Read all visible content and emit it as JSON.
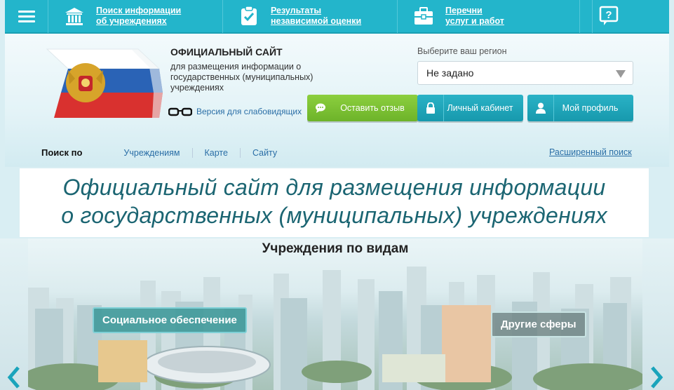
{
  "topnav": {
    "items": [
      {
        "label_line1": "Поиск информации",
        "label_line2": "об учреждениях",
        "icon": "institution-icon"
      },
      {
        "label_line1": "Результаты",
        "label_line2": "независимой оценки",
        "icon": "clipboard-check-icon"
      },
      {
        "label_line1": "Перечни",
        "label_line2": "услуг и работ",
        "icon": "briefcase-icon"
      }
    ],
    "help_icon": "help-chat-icon",
    "menu_icon": "hamburger-icon"
  },
  "header": {
    "title": "ОФИЦИАЛЬНЫЙ САЙТ",
    "description": "для размещения информации о государственных (муниципальных) учреждениях",
    "low_vision_label": "Версия для слабовидящих",
    "region_label": "Выберите ваш регион",
    "region_value": "Не задано"
  },
  "buttons": {
    "feedback": "Оставить отзыв",
    "cabinet": "Личный кабинет",
    "profile": "Мой профиль"
  },
  "search": {
    "lead": "Поиск по",
    "tabs": [
      "Учреждениям",
      "Карте",
      "Сайту"
    ],
    "advanced": "Расширенный поиск"
  },
  "caption": {
    "line1": "Официальный сайт для размещения информации",
    "line2": "о государственных (муниципальных) учреждениях"
  },
  "banner": {
    "title": "Учреждения по видам",
    "tag_social": "Социальное обеспечение",
    "tag_other": "Другие сферы"
  },
  "colors": {
    "nav": "#23b5cb",
    "green": "#7ac035",
    "teal": "#1ea6ba",
    "link": "#2a6ea6",
    "caption_text": "#1b6572"
  }
}
